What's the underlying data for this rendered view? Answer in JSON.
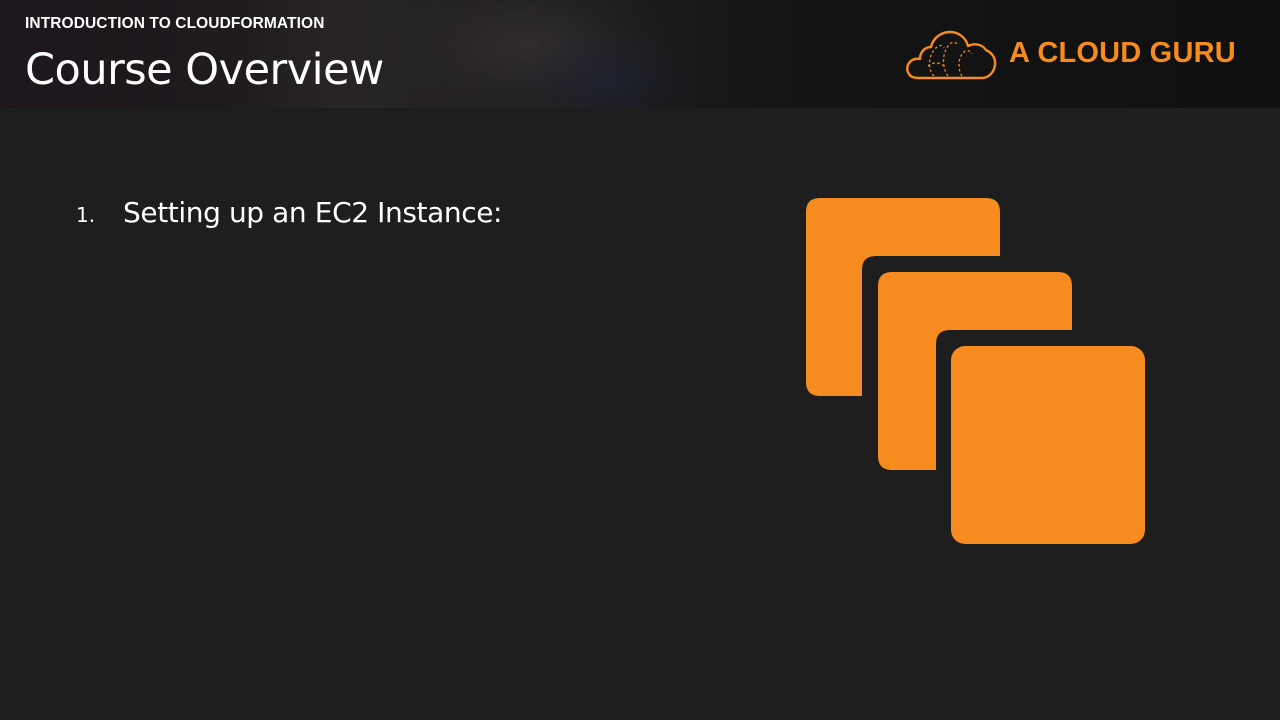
{
  "header": {
    "course_label": "INTRODUCTION TO CLOUDFORMATION",
    "title": "Course Overview",
    "brand_name": "A CLOUD GURU",
    "brand_icon": "cloud-guru-logo-icon"
  },
  "content": {
    "items": [
      {
        "number": "1.",
        "text": "Setting up an EC2 Instance:"
      }
    ]
  },
  "illustration": {
    "icon": "ec2-instances-icon",
    "color": "#f68b1f"
  },
  "colors": {
    "background": "#1e1e1e",
    "accent": "#f68b1f",
    "text": "#ffffff"
  }
}
